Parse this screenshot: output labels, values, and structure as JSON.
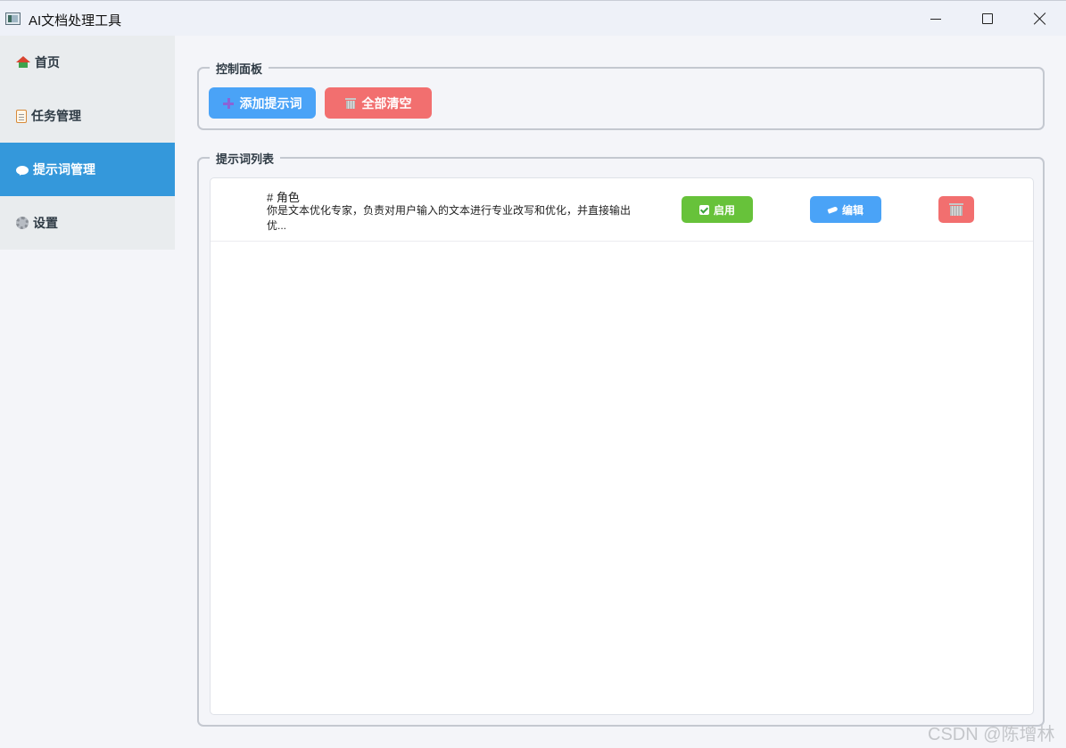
{
  "window": {
    "title": "AI文档处理工具",
    "controls": [
      "minimize",
      "maximize",
      "close"
    ]
  },
  "sidebar": {
    "items": [
      {
        "label": "首页",
        "icon": "home-icon",
        "active": false
      },
      {
        "label": "任务管理",
        "icon": "clipboard-icon",
        "active": false
      },
      {
        "label": "提示词管理",
        "icon": "speech-bubble-icon",
        "active": true
      },
      {
        "label": "设置",
        "icon": "gear-icon",
        "active": false
      }
    ]
  },
  "control_panel": {
    "title": "控制面板",
    "add_label": "添加提示词",
    "clear_label": "全部清空"
  },
  "prompt_list": {
    "title": "提示词列表",
    "rows": [
      {
        "title": "# 角色",
        "description": "你是文本优化专家，负责对用户输入的文本进行专业改写和优化，并直接输出优...",
        "enable_label": "启用",
        "edit_label": "编辑"
      }
    ]
  },
  "colors": {
    "active_nav": "#3498db",
    "primary_button": "#4aa3f7",
    "danger_button": "#f26f6f",
    "success_button": "#67c23a"
  },
  "watermark": "CSDN @陈增林"
}
